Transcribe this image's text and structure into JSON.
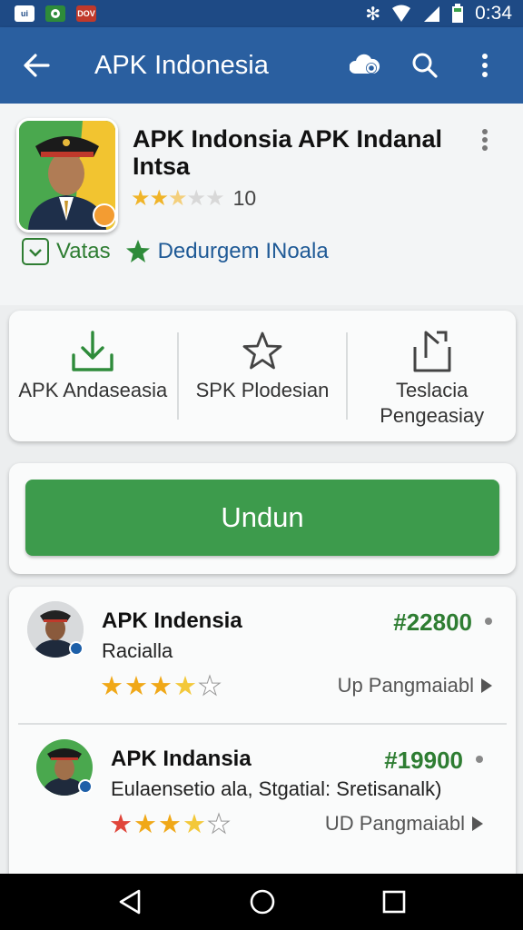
{
  "status_bar": {
    "time": "0:34",
    "notifications": [
      {
        "label": "ui",
        "color": "#ffffff",
        "text_color": "#1e4a85"
      },
      {
        "label": "",
        "color": "#2e8b3a",
        "text_color": "#ffffff"
      },
      {
        "label": "DOV",
        "color": "#c0392b",
        "text_color": "#ffffff"
      }
    ]
  },
  "app_bar": {
    "title": "APK Indonesia"
  },
  "app": {
    "name": "APK Indonsia APK Indanal Intsa",
    "rating": 2.5,
    "rating_text": "10",
    "verified_label": "Vatas",
    "developer": "Dedurgem INoala"
  },
  "actions": [
    {
      "label": "APK Andaseasia",
      "icon": "download-icon"
    },
    {
      "label": "SPK Plodesian",
      "icon": "star-outline-icon"
    },
    {
      "label": "Teslacia Pengeasiay",
      "icon": "share-icon"
    }
  ],
  "download_button": "Undun",
  "list": [
    {
      "title": "APK Indensia",
      "subtitle": "Racialla",
      "price": "#22800",
      "stars": 3.5,
      "action": "Up Pangmaiabl"
    },
    {
      "title": "APK Indansia",
      "subtitle": "Eulaensetio ala, Stgatial: Sretisanalk)",
      "price": "#19900",
      "stars": 3.5,
      "action": "UD Pangmaiabl"
    }
  ],
  "colors": {
    "primary": "#2a5fa0",
    "status_bar": "#1e4a85",
    "accent_green": "#3d9b4c",
    "price_green": "#2e7d32",
    "star_gold": "#f0b428"
  }
}
